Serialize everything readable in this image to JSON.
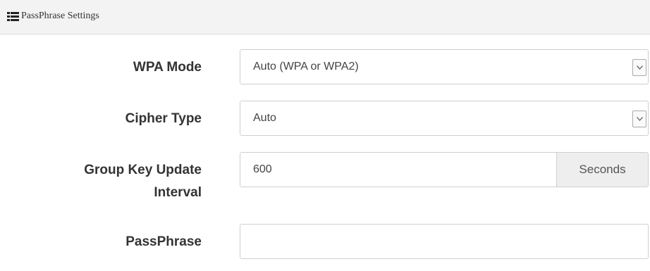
{
  "panel": {
    "title": "PassPhrase Settings",
    "icon": "list-icon"
  },
  "form": {
    "wpa_mode": {
      "label": "WPA Mode",
      "selected": "Auto (WPA or WPA2)"
    },
    "cipher_type": {
      "label": "Cipher Type",
      "selected": "Auto"
    },
    "group_key_update_interval": {
      "label_line1": "Group Key Update",
      "label_line2": "Interval",
      "value": "600",
      "unit": "Seconds"
    },
    "passphrase": {
      "label": "PassPhrase",
      "value": ""
    }
  }
}
